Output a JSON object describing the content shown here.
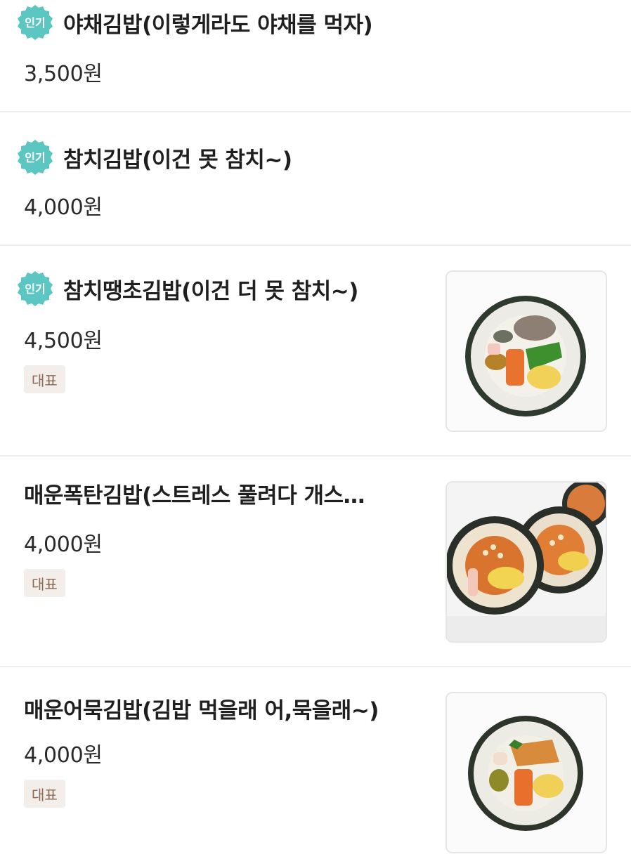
{
  "menu": {
    "items": [
      {
        "name": "야채김밥(이렇게라도 야채를 먹자)",
        "price": "3,500원",
        "badge": "인기",
        "tag": null,
        "image": null
      },
      {
        "name": "참치김밥(이건 못 참치~)",
        "price": "4,000원",
        "badge": "인기",
        "tag": null,
        "image": null
      },
      {
        "name": "참치땡초김밥(이건 더 못 참치~)",
        "price": "4,500원",
        "badge": "인기",
        "tag": "대표",
        "image": "gimbap-photo"
      },
      {
        "name": "매운폭탄김밥(스트레스 풀려다 개스…",
        "price": "4,000원",
        "badge": null,
        "tag": "대표",
        "image": "gimbap-photo"
      },
      {
        "name": "매운어묵김밥(김밥 먹을래 어,묵을래~)",
        "price": "4,000원",
        "badge": null,
        "tag": "대표",
        "image": "gimbap-photo"
      }
    ]
  },
  "colors": {
    "badge": "#5cc6c2",
    "tag_bg": "#f3eeea",
    "tag_text": "#8a6a55",
    "divider": "#eeeeee"
  }
}
